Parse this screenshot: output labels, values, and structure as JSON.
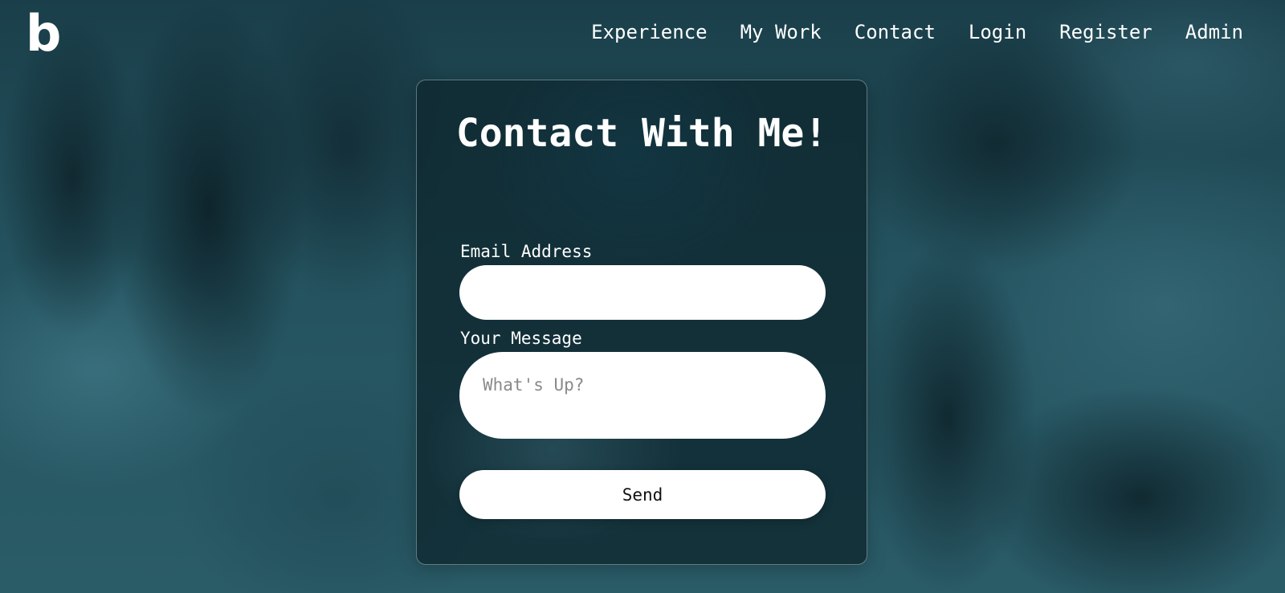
{
  "header": {
    "logo_text": "b",
    "nav": [
      {
        "label": "Experience"
      },
      {
        "label": "My Work"
      },
      {
        "label": "Contact"
      },
      {
        "label": "Login"
      },
      {
        "label": "Register"
      },
      {
        "label": "Admin"
      }
    ]
  },
  "contact_form": {
    "title": "Contact With Me!",
    "email_label": "Email Address",
    "email_value": "",
    "message_label": "Your Message",
    "message_placeholder": "What's Up?",
    "send_label": "Send"
  },
  "colors": {
    "card_background": "#0e262e",
    "field_background": "#ffffff",
    "text": "#ffffff"
  }
}
